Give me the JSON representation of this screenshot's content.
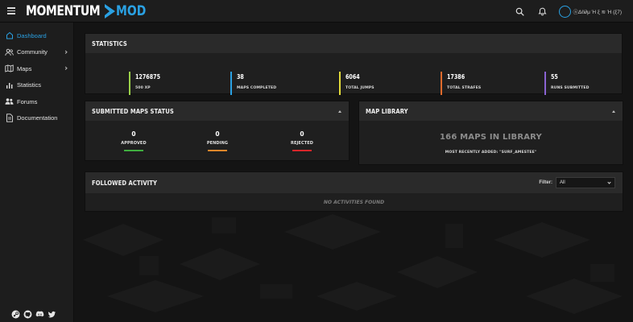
{
  "brand": {
    "word": "MOMENTUM",
    "suffix": "MOD",
    "accent": "#2aa1e3"
  },
  "user": {
    "name": "ⓝΔℓi∂μ Ή ξ ≋ Ή (ξ7)"
  },
  "sidebar": {
    "items": [
      {
        "label": "Dashboard",
        "icon": "home-icon",
        "active": true,
        "expandable": false
      },
      {
        "label": "Community",
        "icon": "users-icon",
        "active": false,
        "expandable": true
      },
      {
        "label": "Maps",
        "icon": "map-icon",
        "active": false,
        "expandable": true
      },
      {
        "label": "Statistics",
        "icon": "chart-icon",
        "active": false,
        "expandable": false
      },
      {
        "label": "Forums",
        "icon": "forum-icon",
        "active": false,
        "expandable": false
      },
      {
        "label": "Documentation",
        "icon": "document-icon",
        "active": false,
        "expandable": false
      }
    ],
    "socials": [
      "steam-icon",
      "github-icon",
      "discord-icon",
      "twitter-icon"
    ]
  },
  "statistics": {
    "title": "STATISTICS",
    "items": [
      {
        "value": "1276875",
        "label": "500 XP",
        "color": "#9bd24a"
      },
      {
        "value": "38",
        "label": "MAPS COMPLETED",
        "color": "#2aa1e3"
      },
      {
        "value": "6064",
        "label": "TOTAL JUMPS",
        "color": "#e3dc3a"
      },
      {
        "value": "17386",
        "label": "TOTAL STRAFES",
        "color": "#e06a2b"
      },
      {
        "value": "55",
        "label": "RUNS SUBMITTED",
        "color": "#8a63d2"
      }
    ]
  },
  "submitted": {
    "title": "SUBMITTED MAPS STATUS",
    "items": [
      {
        "value": "0",
        "label": "APPROVED",
        "color": "#3fae3f"
      },
      {
        "value": "0",
        "label": "PENDING",
        "color": "#e2862a"
      },
      {
        "value": "0",
        "label": "REJECTED",
        "color": "#d8262a"
      }
    ]
  },
  "library": {
    "title": "MAP LIBRARY",
    "count_text": "166 MAPS IN LIBRARY",
    "recent_text": "MOST RECENTLY ADDED: \"SURF_AMESTEE\""
  },
  "activity": {
    "title": "FOLLOWED ACTIVITY",
    "filter_label": "Filter:",
    "filter_value": "All",
    "empty_text": "NO ACTIVITIES FOUND"
  }
}
